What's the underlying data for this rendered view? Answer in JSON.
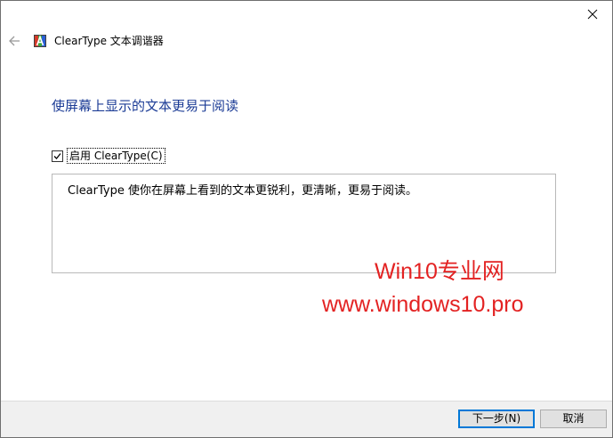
{
  "window": {
    "title": "ClearType 文本调谐器"
  },
  "content": {
    "heading": "使屏幕上显示的文本更易于阅读",
    "checkbox_label": "启用 ClearType(C)",
    "checkbox_checked": true,
    "description": "ClearType 使你在屏幕上看到的文本更锐利，更清晰，更易于阅读。"
  },
  "watermark": {
    "line1": "Win10专业网",
    "line2": "www.windows10.pro",
    "color": "#e32222"
  },
  "footer": {
    "next_label": "下一步(N)",
    "cancel_label": "取消"
  },
  "colors": {
    "heading": "#1c3c96",
    "accent": "#0078d7"
  },
  "icons": {
    "back": "back-arrow-icon",
    "close": "close-icon",
    "app": "cleartype-app-icon",
    "check": "checkmark-icon"
  }
}
